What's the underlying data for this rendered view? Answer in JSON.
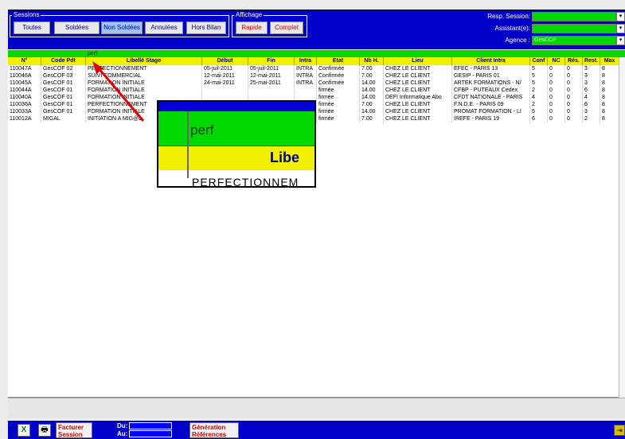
{
  "sessions": {
    "label": "Sessions",
    "buttons": [
      "Toutes",
      "Soldées",
      "Non Soldées",
      "Annulées",
      "Hors Bilan"
    ]
  },
  "affichage": {
    "label": "Affichage",
    "buttons": [
      "Rapide",
      "Complet"
    ]
  },
  "right_filters": {
    "resp_label": "Resp. Session:",
    "resp_value": "",
    "assistant_label": "Assistant(e):",
    "assistant_value": "",
    "agence_label": "Agence :",
    "agence_value": "GesCOF",
    "dropdown_glyph": "▾"
  },
  "filter": {
    "value": "perf"
  },
  "columns": [
    "N°",
    "Code Pdt",
    "Libellé Stage",
    "Début",
    "Fin",
    "Intra",
    "Etat",
    "Nb H.",
    "Lieu",
    "Client Intra",
    "Conf",
    "NC",
    "Rés.",
    "Rest.",
    "Max"
  ],
  "rows": [
    [
      "110047A",
      "GesCOF 02",
      "PERFECTIONNEMENT",
      "05-juil-2011",
      "05-juil-2011",
      "INTRA",
      "Confirmée",
      "7.00",
      "CHEZ LE CLIENT",
      "EFEC - PARIS 13",
      "5",
      "0",
      "0",
      "3",
      "8"
    ],
    [
      "110046A",
      "GesCOF 03",
      "SUIVI COMMERCIAL",
      "12-mai-2011",
      "12-mai-2011",
      "INTRA",
      "Confirmée",
      "7.00",
      "CHEZ LE CLIENT",
      "GESIP - PARIS 01",
      "5",
      "0",
      "0",
      "3",
      "8"
    ],
    [
      "110045A",
      "GesCOF 01",
      "FORMATION INITIALE",
      "24-mai-2011",
      "25-mai-2011",
      "INTRA",
      "Confirmée",
      "14.00",
      "CHEZ LE CLIENT",
      "ARTEK FORMATIONS - N/",
      "5",
      "0",
      "0",
      "3",
      "8"
    ],
    [
      "110044A",
      "GesCOF 01",
      "FORMATION INITIALE",
      "",
      "",
      "",
      "firmée",
      "14.00",
      "CHEZ LE CLIENT",
      "CFBP - PUTEAUX Cedex",
      "2",
      "0",
      "0",
      "6",
      "8"
    ],
    [
      "110040A",
      "GesCOF 01",
      "FORMATION INITIALE",
      "",
      "",
      "",
      "firmée",
      "14.00",
      "DEFI Informatique Abo",
      "CFDT NATIONALE - PARIS",
      "4",
      "0",
      "0",
      "4",
      "8"
    ],
    [
      "110036A",
      "GesCOF 01",
      "PERFECTIONNEMENT",
      "",
      "",
      "",
      "firmée",
      "7.00",
      "CHEZ LE CLIENT",
      "F.N.D.E. - PARIS 09",
      "2",
      "0",
      "0",
      "6",
      "8"
    ],
    [
      "110033A",
      "GesCOF 01",
      "FORMATION INITIALE",
      "",
      "",
      "",
      "firmée",
      "14.00",
      "CHEZ LE CLIENT",
      "PROMAT FORMATION - LI",
      "5",
      "0",
      "0",
      "3",
      "8"
    ],
    [
      "110012A",
      "MIGAL",
      "INITIATION A MIG@L",
      "",
      "",
      "",
      "firmée",
      "7.00",
      "CHEZ LE CLIENT",
      "IREFE - PARIS 19",
      "6",
      "0",
      "0",
      "2",
      "8"
    ]
  ],
  "zoom": {
    "filter_text": "perf",
    "header_text": "Libe",
    "row_text": "PERFECTIONNEM"
  },
  "bottom": {
    "excel_icon": "X",
    "print_icon": "🖶",
    "facturer_label": "Facturer Session",
    "du_label": "Du:",
    "au_label": "Au:",
    "generation_label": "Génération Références",
    "exit_icon": "⇥"
  },
  "colors": {
    "header_blue": "#0000c8",
    "filter_green": "#00d800",
    "header_yellow": "#f0f000",
    "arrow_red": "#e00000"
  }
}
